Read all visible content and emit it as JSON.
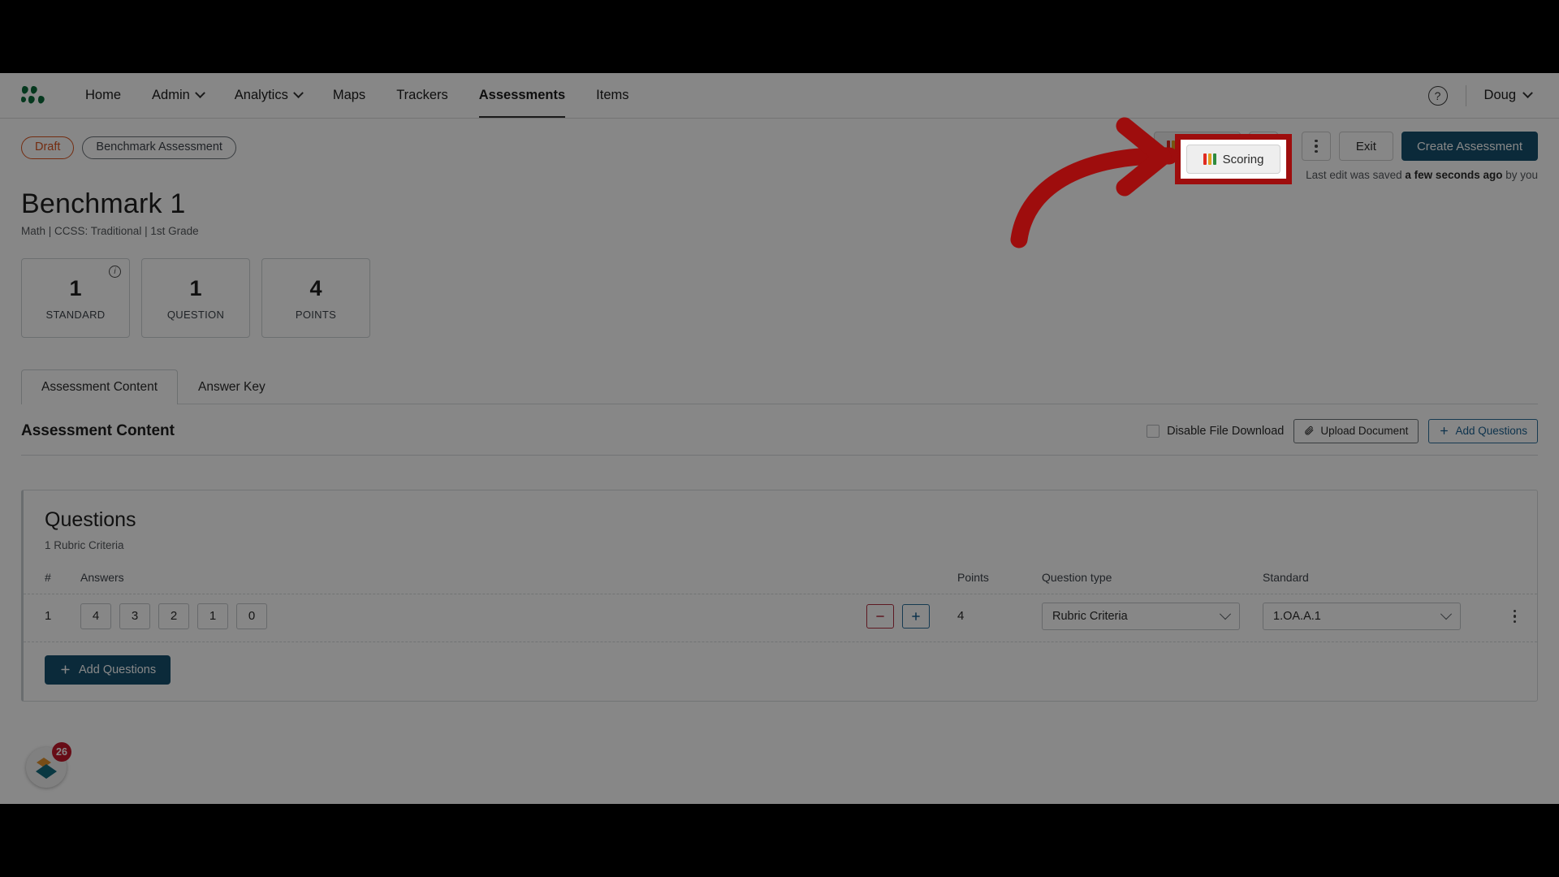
{
  "nav": {
    "logo_icon": "leaf-cluster-logo",
    "links": [
      {
        "label": "Home",
        "has_caret": false,
        "active": false
      },
      {
        "label": "Admin",
        "has_caret": true,
        "active": false
      },
      {
        "label": "Analytics",
        "has_caret": true,
        "active": false
      },
      {
        "label": "Maps",
        "has_caret": false,
        "active": false
      },
      {
        "label": "Trackers",
        "has_caret": false,
        "active": false
      },
      {
        "label": "Assessments",
        "has_caret": false,
        "active": true
      },
      {
        "label": "Items",
        "has_caret": false,
        "active": false
      }
    ],
    "help_icon": "question-mark-circle-icon",
    "user_label": "Doug",
    "user_caret_icon": "chevron-down-icon"
  },
  "header": {
    "status_chip": "Draft",
    "type_chip": "Benchmark Assessment",
    "title": "Benchmark 1",
    "subtitle": "Math  |  CCSS: Traditional  |  1st Grade",
    "saved_note_prefix": "Last edit was saved ",
    "saved_note_strong": "a few seconds ago",
    "saved_note_suffix": " by you",
    "actions": {
      "scoring_label": "Scoring",
      "scoring_icon": "score-bars-icon",
      "scoring_bar_colors": [
        "#e02b20",
        "#e0a020",
        "#2e8b3d"
      ],
      "settings_icon": "gear-icon",
      "more_icon": "kebab-menu-icon",
      "exit_label": "Exit",
      "create_label": "Create Assessment",
      "primary_color": "#15506e"
    }
  },
  "stats": [
    {
      "value": "1",
      "label": "STANDARD",
      "info_icon": "info-circle-icon"
    },
    {
      "value": "1",
      "label": "QUESTION",
      "info_icon": ""
    },
    {
      "value": "4",
      "label": "POINTS",
      "info_icon": ""
    }
  ],
  "tabs": [
    {
      "label": "Assessment Content",
      "active": true
    },
    {
      "label": "Answer Key",
      "active": false
    }
  ],
  "content_section": {
    "title": "Assessment Content",
    "disable_download_label": "Disable File Download",
    "disable_download_checked": false,
    "upload_label": "Upload Document",
    "upload_icon": "paperclip-icon",
    "add_questions_label": "Add Questions",
    "add_questions_icon": "plus-icon"
  },
  "questions_card": {
    "title": "Questions",
    "subtitle": "1 Rubric Criteria",
    "columns": {
      "number": "#",
      "answers": "Answers",
      "points": "Points",
      "question_type": "Question type",
      "standard": "Standard"
    },
    "rows": [
      {
        "number": "1",
        "answers": [
          "4",
          "3",
          "2",
          "1",
          "0"
        ],
        "minus_icon": "minus-icon",
        "plus_icon": "plus-icon",
        "points": "4",
        "question_type": "Rubric Criteria",
        "standard": "1.OA.A.1",
        "row_menu_icon": "kebab-menu-icon",
        "select_caret_icon": "chevron-down-icon"
      }
    ],
    "add_questions_label": "Add Questions",
    "add_questions_icon": "plus-icon"
  },
  "floating_widget": {
    "icon": "diamond-stack-icon",
    "badge_count": "26"
  },
  "annotation": {
    "arrow_icon": "curved-arrow-right",
    "arrow_color": "#9e0d0d",
    "highlight_color": "#9e0d0d",
    "highlight_target": "Scoring"
  }
}
